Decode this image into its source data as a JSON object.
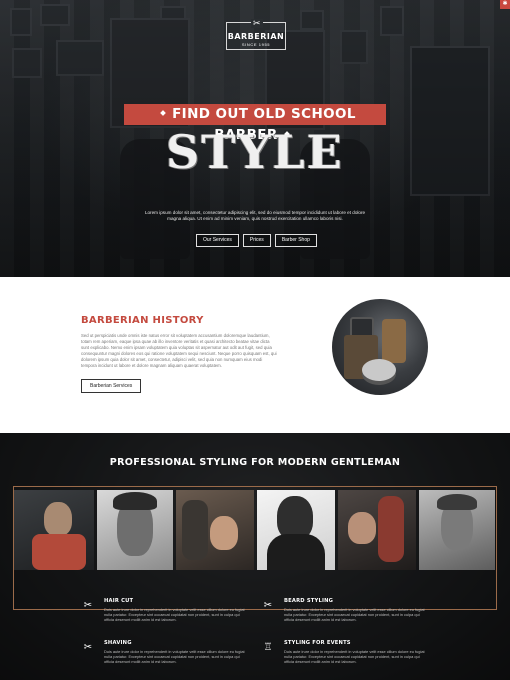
{
  "brand": {
    "name": "BARBERIAN",
    "since": "SINCE 1955"
  },
  "hero": {
    "tagline": "FIND OUT OLD SCHOOL BARBER",
    "headline": "STYLE",
    "text": "Lorem ipsum dolor sit amet, consectetur adipiscing elit, sed do eiusmod tempor incididunt ut labore et dolore magna aliqua. Ut enim ad minim veniam, quis nostrud exercitation ullamco laboris nisi.",
    "buttons": [
      "Our Services",
      "Prices",
      "Barber Shop"
    ]
  },
  "history": {
    "title": "BARBERIAN HISTORY",
    "text": "Sed ut perspiciatis unde omnis iste natus error sit voluptatem accusantium doloremque laudantium, totam rem aperiam, eaque ipsa quae ab illo inventore veritatis et quasi architecto beatae vitae dicta sunt explicabo. Nemo enim ipsam voluptatem quia voluptas sit aspernatur aut odit aut fugit, sed quia consequuntur magni dolores eos qui ratione voluptatem sequi nesciunt. Neque porro quisquam est, qui dolorem ipsum quia dolor sit amet, consectetur, adipisci velit, sed quia non numquam eius modi tempora incidunt ut labore et dolore magnam aliquam quaerat voluptatem.",
    "button": "Barberian Services"
  },
  "styling": {
    "title": "PROFESSIONAL STYLING FOR MODERN GENTLEMAN",
    "services": [
      {
        "title": "HAIR CUT",
        "icon": "scissors-icon",
        "text": "Duis aute irure dolor in reprehenderit in voluptate velit esse cillum dolore eu fugiat nulla pariatur. Excepteur sint occaecat cupidatat non proident, sunt in culpa qui officia deserunt mollit anim id est laborum."
      },
      {
        "title": "BEARD STYLING",
        "icon": "scissors-icon",
        "text": "Duis aute irure dolor in reprehenderit in voluptate velit esse cillum dolore eu fugiat nulla pariatur. Excepteur sint occaecat cupidatat non proident, sunt in culpa qui officia deserunt mollit anim id est laborum."
      },
      {
        "title": "SHAVING",
        "icon": "razor-icon",
        "text": "Duis aute irure dolor in reprehenderit in voluptate velit esse cillum dolore eu fugiat nulla pariatur. Excepteur sint occaecat cupidatat non proident, sunt in culpa qui officia deserunt mollit anim id est laborum."
      },
      {
        "title": "STYLING FOR EVENTS",
        "icon": "barber-chair-icon",
        "text": "Duis aute irure dolor in reprehenderit in voluptate velit esse cillum dolore eu fugiat nulla pariatur. Excepteur sint occaecat cupidatat non proident, sunt in culpa qui officia deserunt mollit anim id est laborum."
      }
    ]
  },
  "colors": {
    "accent": "#c44a3f",
    "dark": "#1e2124",
    "gold": "#9b6b4a"
  }
}
